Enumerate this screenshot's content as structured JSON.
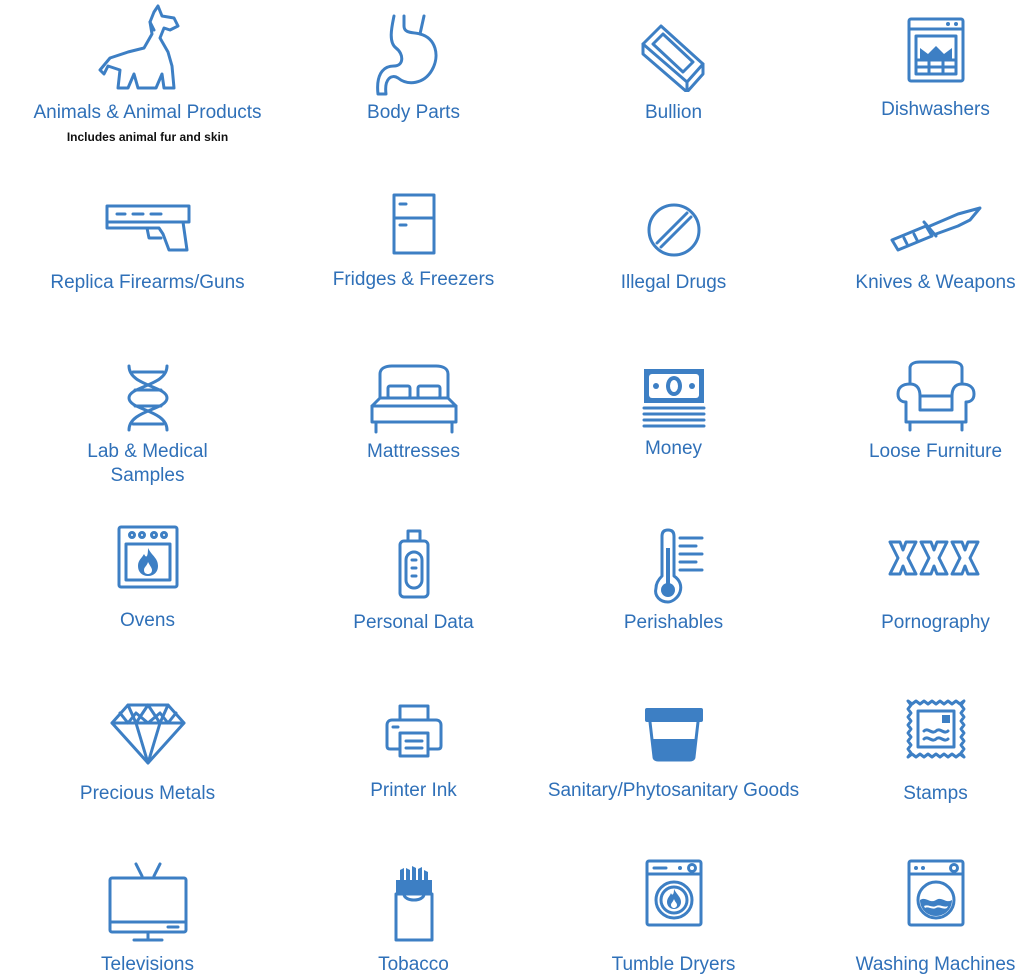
{
  "accent_color": "#2f70b8",
  "items": [
    {
      "label": "Animals & Animal Products",
      "note": "Includes animal fur and skin",
      "icon": "dog-icon"
    },
    {
      "label": "Body Parts",
      "icon": "stomach-icon"
    },
    {
      "label": "Bullion",
      "icon": "gold-bar-icon"
    },
    {
      "label": "Dishwashers",
      "icon": "dishwasher-icon"
    },
    {
      "label": "Replica Firearms/Guns",
      "icon": "gun-icon"
    },
    {
      "label": "Fridges & Freezers",
      "icon": "fridge-icon"
    },
    {
      "label": "Illegal Drugs",
      "icon": "pill-icon"
    },
    {
      "label": "Knives & Weapons",
      "icon": "knife-icon"
    },
    {
      "label": "Lab & Medical Samples",
      "icon": "dna-icon"
    },
    {
      "label": "Mattresses",
      "icon": "bed-icon"
    },
    {
      "label": "Money",
      "icon": "banknotes-icon"
    },
    {
      "label": "Loose Furniture",
      "icon": "armchair-icon"
    },
    {
      "label": "Ovens",
      "icon": "oven-icon"
    },
    {
      "label": "Personal Data",
      "icon": "usb-drive-icon"
    },
    {
      "label": "Perishables",
      "icon": "thermometer-icon"
    },
    {
      "label": "Pornography",
      "icon": "xxx-icon"
    },
    {
      "label": "Precious Metals",
      "icon": "diamond-icon"
    },
    {
      "label": "Printer Ink",
      "icon": "printer-icon"
    },
    {
      "label": "Sanitary/Phytosanitary Goods",
      "icon": "container-icon"
    },
    {
      "label": "Stamps",
      "icon": "stamp-icon"
    },
    {
      "label": "Televisions",
      "icon": "television-icon"
    },
    {
      "label": "Tobacco",
      "icon": "cigarettes-icon"
    },
    {
      "label": "Tumble Dryers",
      "icon": "tumble-dryer-icon"
    },
    {
      "label": "Washing Machines",
      "icon": "washing-machine-icon"
    }
  ]
}
